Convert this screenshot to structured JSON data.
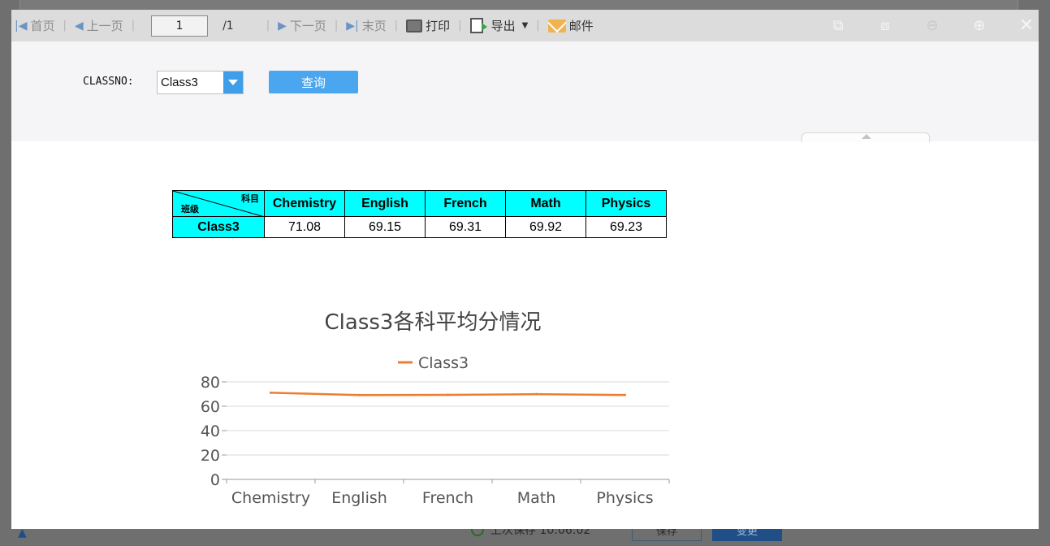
{
  "toolbar": {
    "first_label": "首页",
    "prev_label": "上一页",
    "page_current": "1",
    "page_total": "/1",
    "next_label": "下一页",
    "last_label": "末页",
    "print_label": "打印",
    "export_label": "导出",
    "mail_label": "邮件"
  },
  "query": {
    "field_label": "CLASSNO:",
    "selected_class": "Class3",
    "submit_label": "查询"
  },
  "table": {
    "corner_top": "科目",
    "corner_bottom": "班级",
    "headers": [
      "Chemistry",
      "English",
      "French",
      "Math",
      "Physics"
    ],
    "row_label": "Class3",
    "values": [
      "71.08",
      "69.15",
      "69.31",
      "69.92",
      "69.23"
    ]
  },
  "chart_data": {
    "type": "line",
    "title": "Class3各科平均分情况",
    "categories": [
      "Chemistry",
      "English",
      "French",
      "Math",
      "Physics"
    ],
    "series": [
      {
        "name": "Class3",
        "values": [
          71.08,
          69.15,
          69.31,
          69.92,
          69.23
        ],
        "color": "#ed7d31"
      }
    ],
    "yticks": [
      "0",
      "20",
      "40",
      "60",
      "80"
    ],
    "ylim": [
      0,
      80
    ],
    "grid": true,
    "legend": "top-center"
  },
  "background": {
    "status_text": "上次保存 10:06:02",
    "save_label": "保存",
    "change_label": "变更"
  },
  "colors": {
    "header_cyan": "#00ffff",
    "accent_blue": "#4aa6ee",
    "series_orange": "#ed7d31"
  }
}
